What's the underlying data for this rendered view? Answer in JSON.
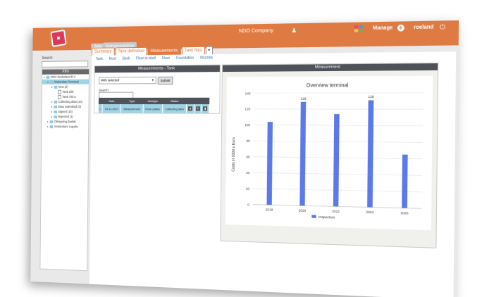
{
  "header": {
    "company": "NDO Company",
    "manage_label": "Manage",
    "username": "roeland"
  },
  "tabs": {
    "jobs": "Jobs",
    "inactive": "Instrumentation",
    "main": [
      "Summary",
      "Tank definition",
      "Measurements",
      "Tank files"
    ]
  },
  "sidebar": {
    "search_label": "Search:",
    "tree_title": "Jobs",
    "items": [
      {
        "label": "NDO Nederland B.V.",
        "level": 0,
        "type": "folder"
      },
      {
        "label": "Rotterdam Terminal",
        "level": 1,
        "type": "folder",
        "selected": true
      },
      {
        "label": "New (2)",
        "level": 2,
        "type": "folder"
      },
      {
        "label": "Tank 209",
        "level": 3,
        "type": "file"
      },
      {
        "label": "Tank 700 a",
        "level": 3,
        "type": "file"
      },
      {
        "label": "Collecting data (10)",
        "level": 2,
        "type": "folder"
      },
      {
        "label": "Data submitted (0)",
        "level": 2,
        "type": "folder"
      },
      {
        "label": "Signed (10)",
        "level": 2,
        "type": "folder"
      },
      {
        "label": "Rejected (1)",
        "level": 2,
        "type": "folder"
      },
      {
        "label": "Ottergoing Barlab",
        "level": 1,
        "type": "folder"
      },
      {
        "label": "Amsterdam Liquids",
        "level": 1,
        "type": "folder"
      }
    ]
  },
  "subtabs": [
    "Tank",
    "Roof",
    "Shell",
    "Floor to shell",
    "Floor",
    "Foundation",
    "Nozzles"
  ],
  "measurements_panel": {
    "title": "Measurements - Tank",
    "select_value": "With selected",
    "submit_label": "Submit",
    "search_label": "Search:",
    "columns": [
      "",
      "Date",
      "Type",
      "Subtype",
      "Status",
      "",
      "",
      ""
    ],
    "rows": [
      {
        "date": "10-11-2017",
        "type": "Measurement",
        "subtype": "Floor plates",
        "status": "Collecting data"
      }
    ]
  },
  "measurement_panel": {
    "title": "Measurement"
  },
  "colors": {
    "accent": "#e07a43",
    "bar": "#5c79e8",
    "selection": "#9fd3e6"
  },
  "chart_data": {
    "type": "bar",
    "title": "Overview terminal",
    "ylabel": "Costs in 1000 x Euro",
    "categories": [
      "2018",
      "2020",
      "2022",
      "2024",
      "2026"
    ],
    "ylim": [
      0,
      140
    ],
    "yticks": [
      0,
      20,
      40,
      60,
      80,
      100,
      120,
      140
    ],
    "series": [
      {
        "name": "Inspection",
        "values": [
          104,
          129,
          114,
          131,
          65
        ]
      }
    ],
    "data_labels": [
      "",
      "129",
      "",
      "128",
      ""
    ],
    "legend_position": "bottom"
  }
}
